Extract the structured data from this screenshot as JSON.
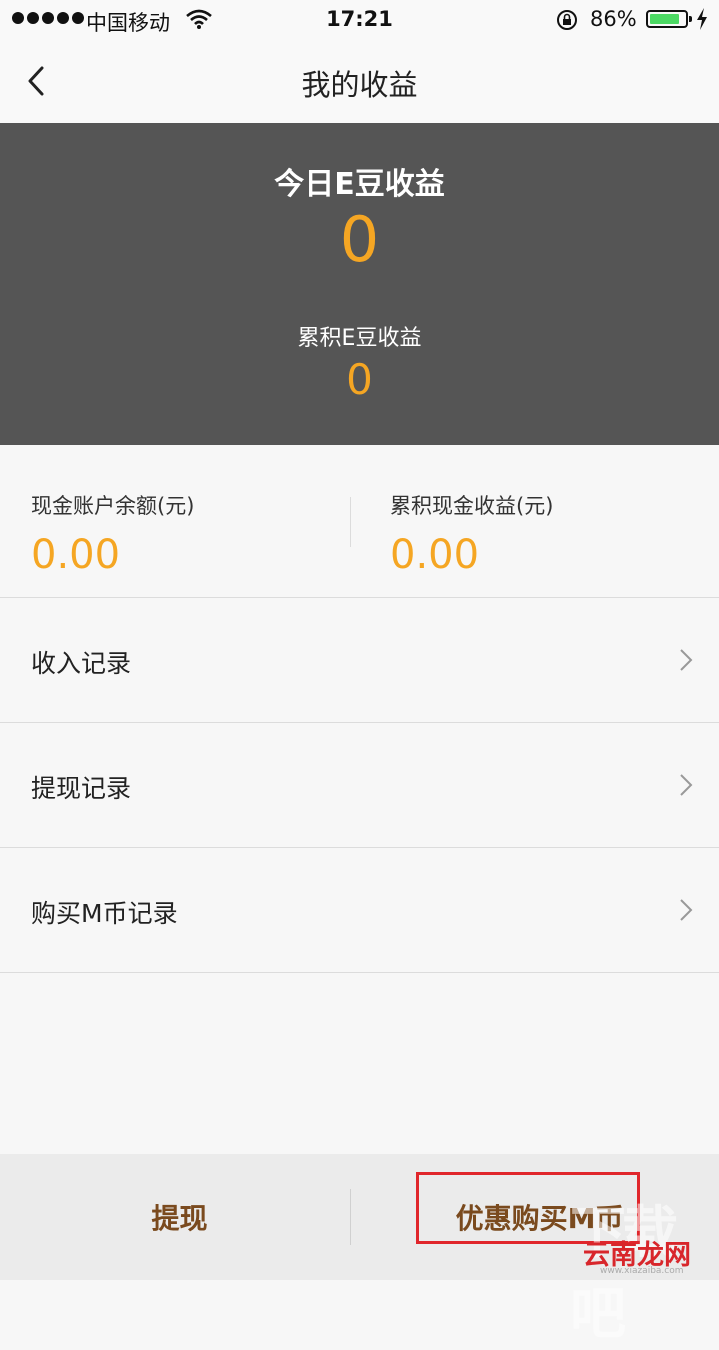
{
  "status_bar": {
    "carrier": "中国移动",
    "time": "17:21",
    "battery_percent": "86%",
    "battery_level": 0.86,
    "signal_icon": "signal-dots-icon",
    "wifi_icon": "wifi-icon",
    "lock_icon": "rotation-lock-icon",
    "charging_icon": "bolt-icon"
  },
  "nav": {
    "title": "我的收益",
    "back_icon": "chevron-left-icon"
  },
  "hero": {
    "today_label": "今日E豆收益",
    "today_value": "0",
    "total_label": "累积E豆收益",
    "total_value": "0"
  },
  "cash": {
    "balance_label": "现金账户余额(元)",
    "balance_value": "0.00",
    "total_label": "累积现金收益(元)",
    "total_value": "0.00"
  },
  "list": [
    {
      "label": "收入记录"
    },
    {
      "label": "提现记录"
    },
    {
      "label": "购买M币记录"
    }
  ],
  "bottom": {
    "withdraw_label": "提现",
    "buy_label": "优惠购买M币"
  },
  "watermark": {
    "brand": "云南龙网",
    "url": "www.xiazaiba.com"
  },
  "colors": {
    "accent": "#f5a623",
    "hero_bg": "#555555",
    "button_text": "#7a4a1e",
    "highlight": "#e0262b",
    "page_bg": "#f7f7f7"
  }
}
